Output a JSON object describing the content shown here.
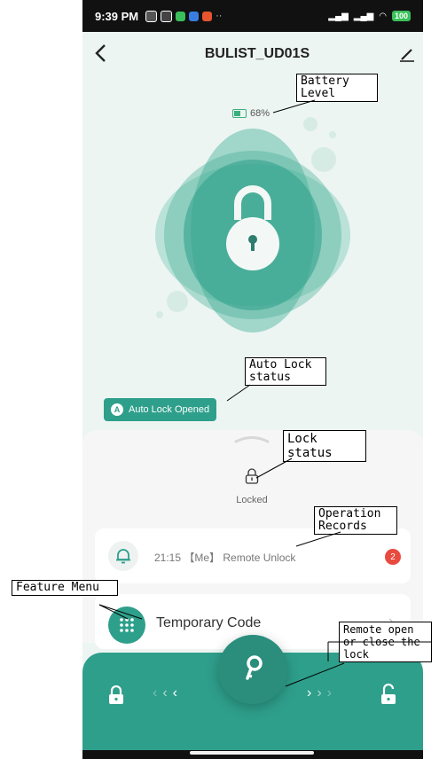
{
  "status_bar": {
    "time": "9:39 PM",
    "battery": "100"
  },
  "header": {
    "title": "BULIST_UD01S",
    "back_icon": "chevron-left-icon",
    "edit_icon": "pencil-icon"
  },
  "battery": {
    "level_text": "68%",
    "level": 0.68
  },
  "auto_lock": {
    "badge": "A",
    "label": "Auto Lock Opened"
  },
  "lock_status": {
    "label": "Locked"
  },
  "records": {
    "text": "21:15 【Me】 Remote Unlock",
    "badge": "2"
  },
  "feature": {
    "label": "Temporary Code"
  },
  "callouts": {
    "battery": "Battery Level",
    "auto_lock": "Auto Lock status",
    "lock_status": "Lock status",
    "operation": "Operation Records",
    "feature": "Feature Menu",
    "remote": "Remote open or close the lock"
  },
  "colors": {
    "accent": "#2e9f8b",
    "badge": "#e84a3f",
    "background": "#ecf5f2"
  }
}
